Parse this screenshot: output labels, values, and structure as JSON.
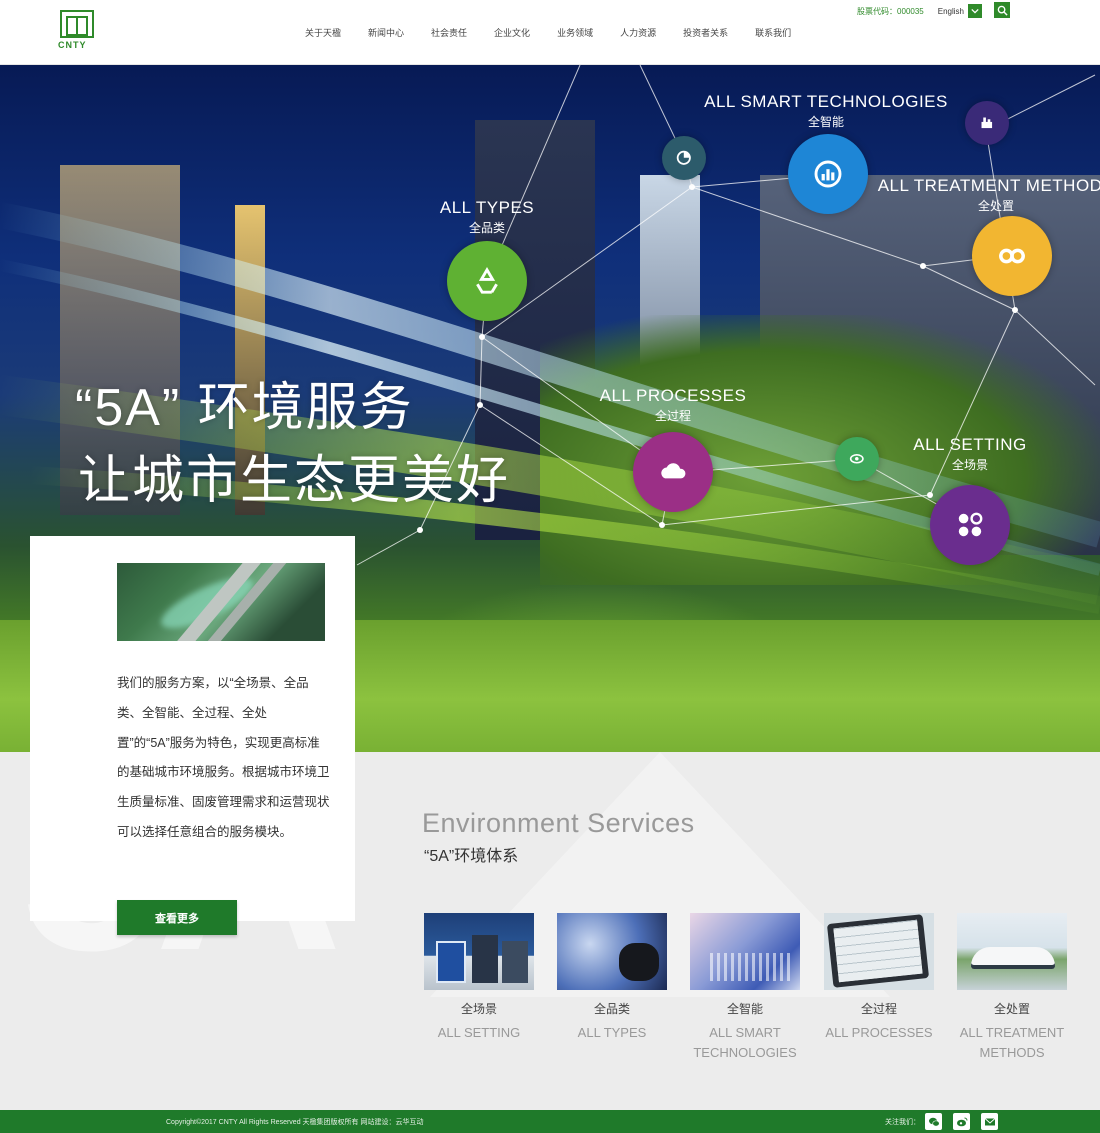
{
  "header": {
    "logo_text": "CNTY",
    "nav": [
      "关于天楹",
      "新闻中心",
      "社会责任",
      "企业文化",
      "业务领域",
      "人力资源",
      "投资者关系",
      "联系我们"
    ],
    "stock_label": "股票代码：000035",
    "language": "English"
  },
  "hero": {
    "headline_1": "“5A” 环境服务",
    "headline_2": "让城市生态更美好",
    "nodes": [
      {
        "en": "ALL TYPES",
        "cn": "全品类"
      },
      {
        "en": "ALL SMART TECHNOLOGIES",
        "cn": "全智能"
      },
      {
        "en": "ALL TREATMENT METHODS",
        "cn": "全处置"
      },
      {
        "en": "ALL PROCESSES",
        "cn": "全过程"
      },
      {
        "en": "ALL SETTING",
        "cn": "全场景"
      }
    ],
    "colors": {
      "types": "#5fb133",
      "smart": "#1e86d6",
      "treatment": "#f2b631",
      "processes": "#9b2f86",
      "setting": "#6a2d8e"
    }
  },
  "card": {
    "text": "我们的服务方案，以“全场景、全品类、全智能、全过程、全处置”的“5A”服务为特色，实现更高标准的基础城市环境服务。根据城市环境卫生质量标准、固废管理需求和运营现状可以选择任意组合的服务模块。",
    "button": "查看更多"
  },
  "services": {
    "bg_text": "5A",
    "title": "Environment Services",
    "subtitle": "“5A”环境体系",
    "items": [
      {
        "cn": "全场景",
        "en": "ALL SETTING"
      },
      {
        "cn": "全品类",
        "en": "ALL TYPES"
      },
      {
        "cn": "全智能",
        "en": "ALL SMART TECHNOLOGIES"
      },
      {
        "cn": "全过程",
        "en": "ALL PROCESSES"
      },
      {
        "cn": "全处置",
        "en": "ALL TREATMENT METHODS"
      }
    ]
  },
  "footer": {
    "copyright": "Copyright©2017 CNTY All Rights Reserved 天楹集团版权所有     网站建设：云华互动",
    "follow": "关注我们："
  },
  "theme": {
    "brand": "#1f7a2a"
  }
}
